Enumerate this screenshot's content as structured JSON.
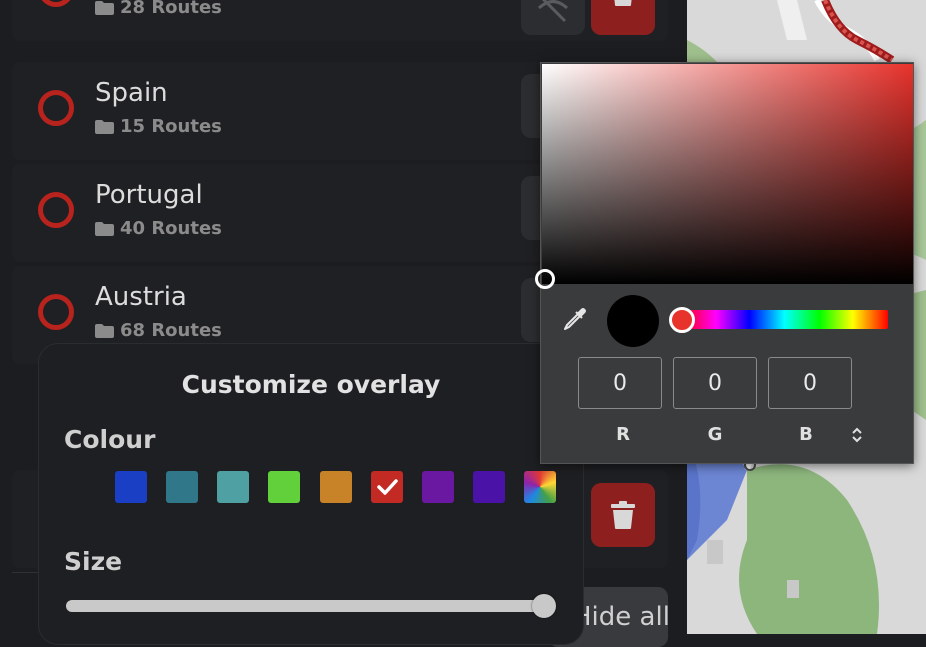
{
  "routes": [
    {
      "name": "",
      "count": "28 Routes"
    },
    {
      "name": "Spain",
      "count": "15 Routes"
    },
    {
      "name": "Portugal",
      "count": "40 Routes"
    },
    {
      "name": "Austria",
      "count": "68 Routes"
    }
  ],
  "hide_all_label": "Hide all",
  "customize": {
    "title": "Customize overlay",
    "colour_label": "Colour",
    "size_label": "Size",
    "size_value": 1.0,
    "swatches": [
      "#1a3fc4",
      "#2f7789",
      "#4ea0a3",
      "#62d03a",
      "#c88328",
      "#c32a24",
      "#6a18a2",
      "#4a12a6",
      "rainbow"
    ],
    "selected_swatch": 5
  },
  "picker": {
    "hue_color": "#e8322c",
    "preview_color": "#000000",
    "r": "0",
    "g": "0",
    "b": "0",
    "labels": {
      "r": "R",
      "g": "G",
      "b": "B"
    }
  },
  "colors": {
    "accent_red": "#b8231e",
    "trash_bg": "#8e1f1f"
  }
}
